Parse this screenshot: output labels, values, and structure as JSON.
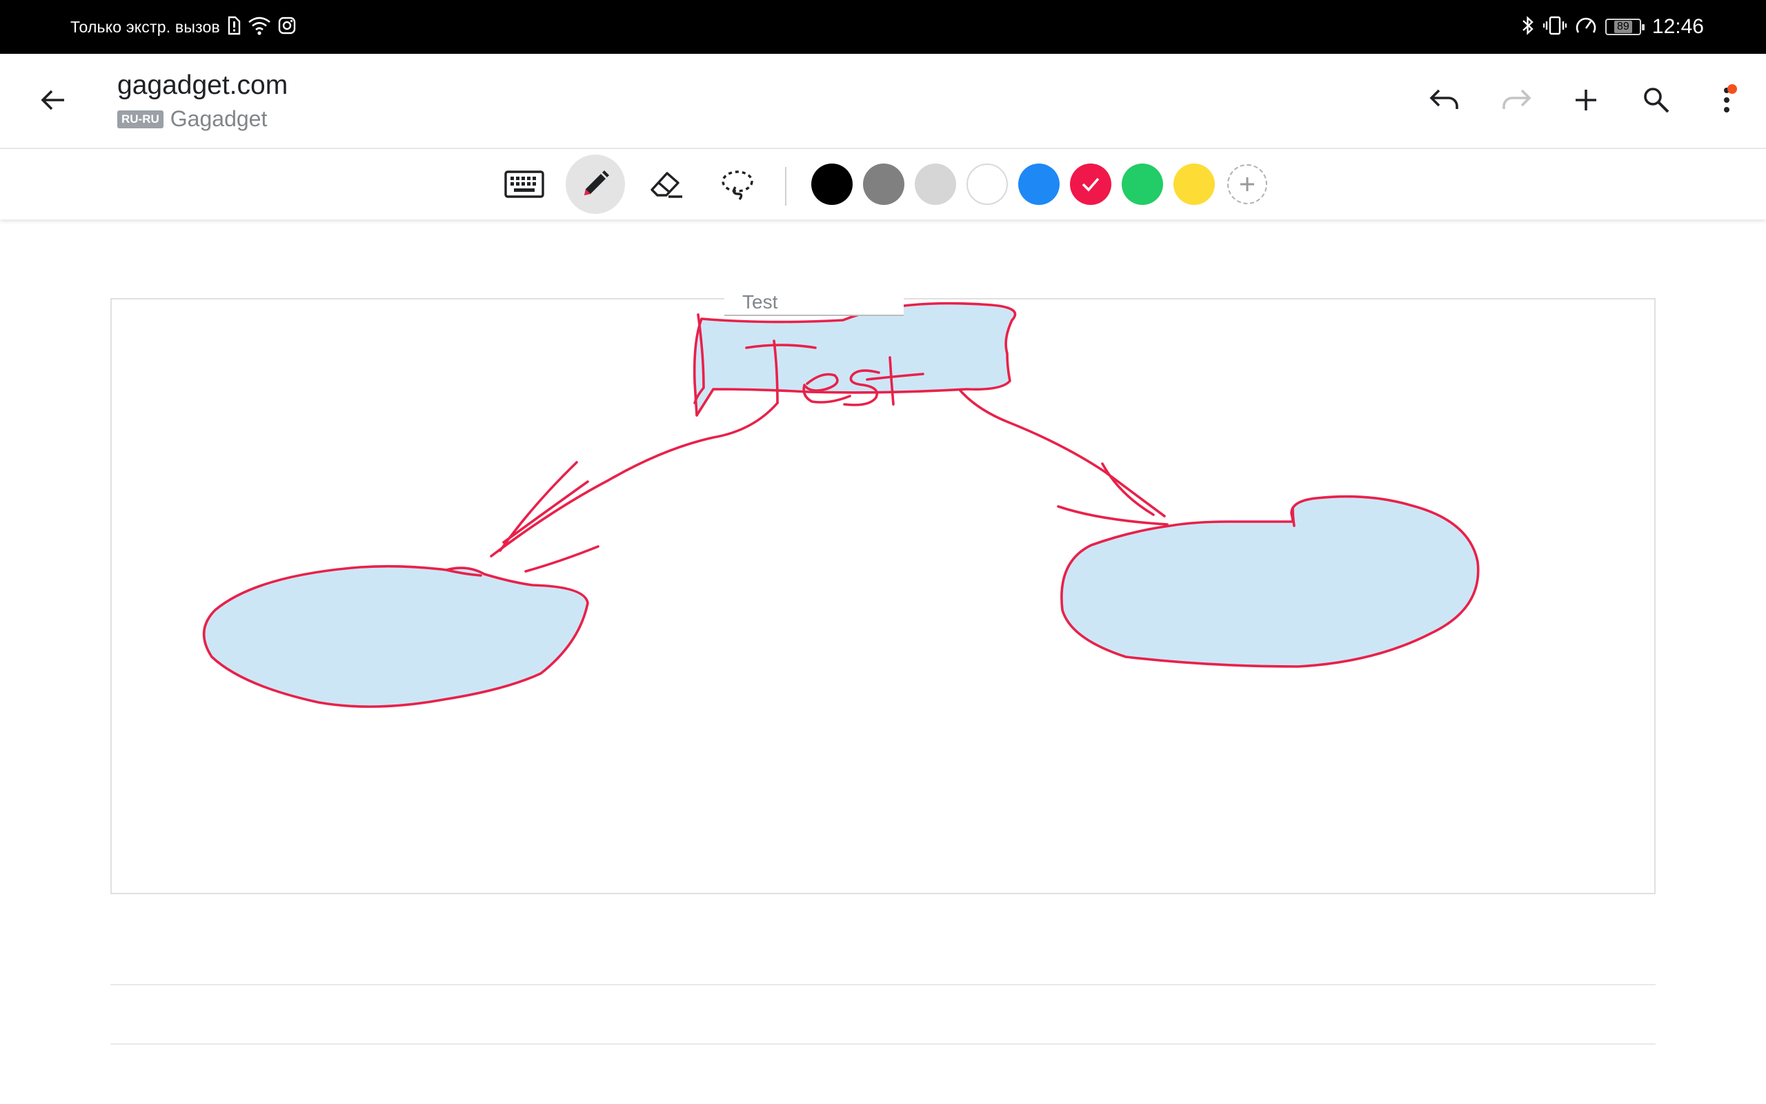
{
  "status_bar": {
    "carrier_text": "Только экстр. вызов",
    "battery_level": "89",
    "time": "12:46"
  },
  "app_bar": {
    "title": "gagadget.com",
    "language_badge": "RU-RU",
    "subtitle": "Gagadget"
  },
  "toolbar": {
    "tools": [
      "keyboard",
      "pen",
      "eraser",
      "lasso"
    ],
    "active_tool": "pen",
    "colors": [
      "#000000",
      "#808080",
      "#d6d6d6",
      "#ffffff",
      "#1e88f5",
      "#f0174a",
      "#22cc66",
      "#fddc36"
    ],
    "selected_color": "#f0174a"
  },
  "canvas": {
    "drawing_title": "Test",
    "handwritten_text": "Test",
    "stroke_color": "#e8214a",
    "fill_color": "#cde6f6"
  }
}
